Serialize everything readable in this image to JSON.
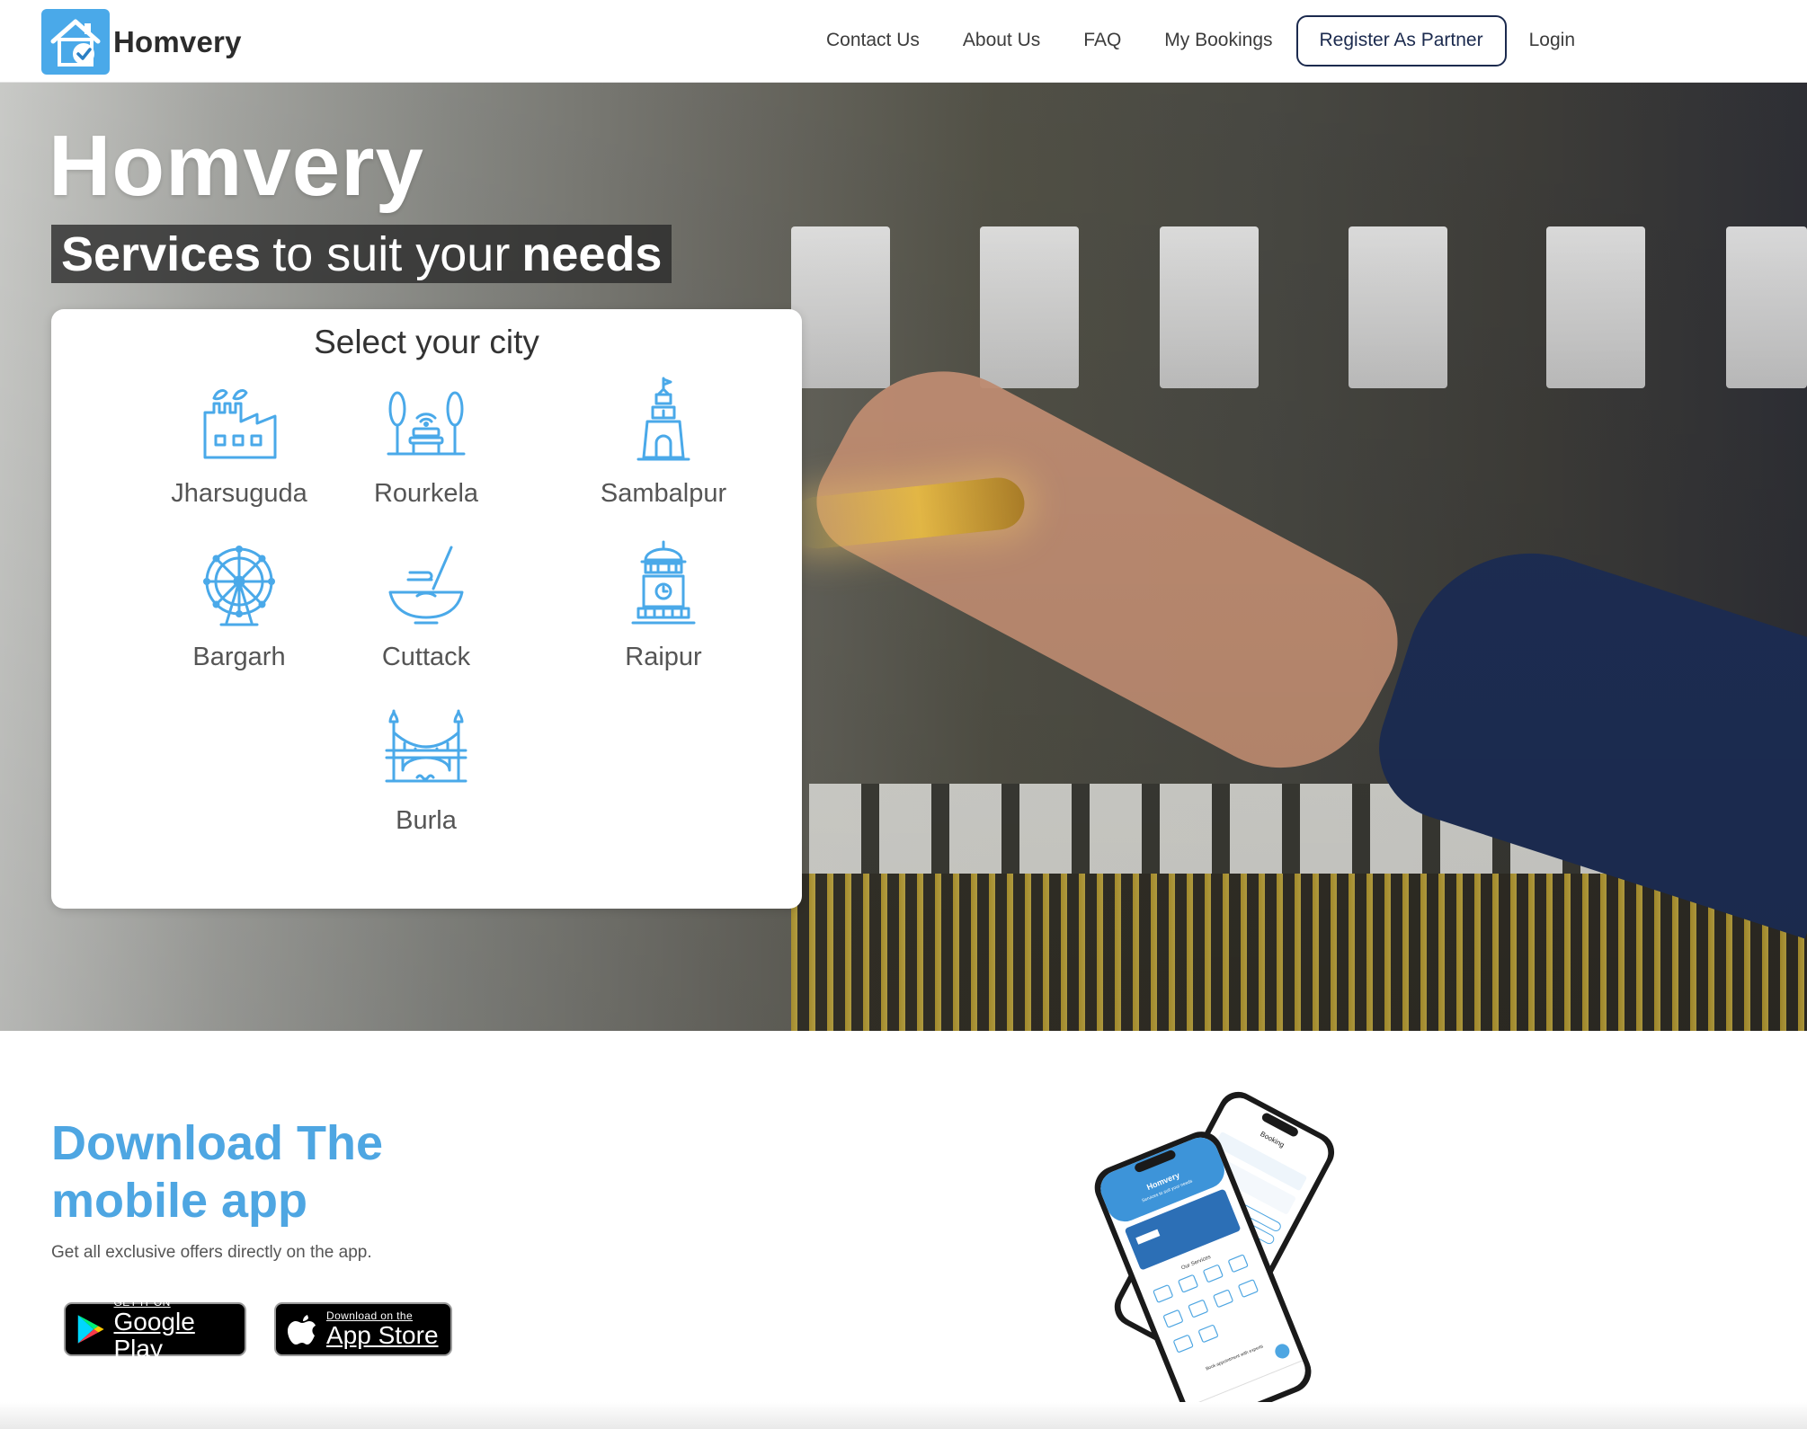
{
  "header": {
    "brand": "Homvery",
    "nav": {
      "contact": "Contact Us",
      "about": "About Us",
      "faq": "FAQ",
      "bookings": "My Bookings",
      "partner": "Register As Partner",
      "login": "Login"
    }
  },
  "hero": {
    "brand": "Homvery",
    "tagline": {
      "strong1": "Services",
      "middle": "to suit your",
      "strong2": "needs"
    }
  },
  "city_selector": {
    "title": "Select your city",
    "cities": [
      {
        "name": "Jharsuguda",
        "icon": "factory-icon"
      },
      {
        "name": "Rourkela",
        "icon": "park-bench-icon"
      },
      {
        "name": "Sambalpur",
        "icon": "temple-icon"
      },
      {
        "name": "Bargarh",
        "icon": "ferris-wheel-icon"
      },
      {
        "name": "Cuttack",
        "icon": "food-bowl-icon"
      },
      {
        "name": "Raipur",
        "icon": "clock-tower-icon"
      },
      {
        "name": "Burla",
        "icon": "bridge-icon"
      }
    ]
  },
  "download": {
    "title_line1": "Download The",
    "title_line2": "mobile app",
    "subtitle": "Get all exclusive offers directly on the app.",
    "google_play": {
      "small": "GET IT ON",
      "big": "Google Play"
    },
    "app_store": {
      "small": "Download on the",
      "big": "App Store"
    }
  },
  "phone_mockup": {
    "screen1": {
      "brand": "Homvery",
      "tagline": "Services to suit your needs",
      "section": "Our Services",
      "cta": "Book appointment with experts"
    },
    "screen2": {
      "title": "Booking"
    }
  },
  "colors": {
    "accent": "#4ea6e2",
    "navy": "#1b2a4e",
    "icon_blue": "#4aa9e9"
  }
}
